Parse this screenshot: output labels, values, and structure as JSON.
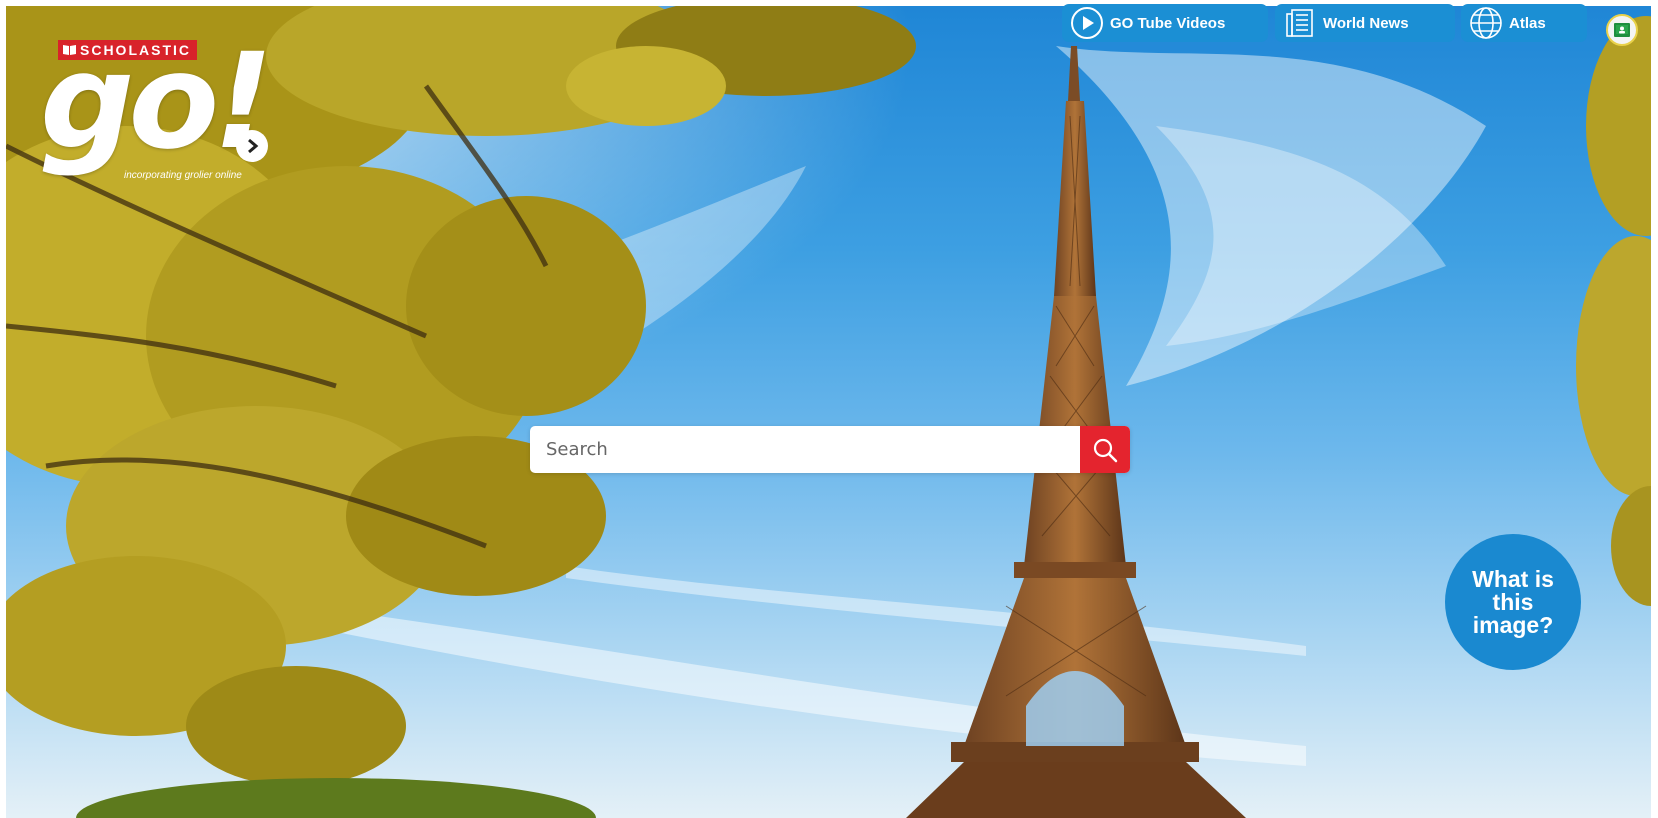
{
  "logo": {
    "brand": "SCHOLASTIC",
    "name": "go!",
    "tagline": "incorporating grolier online"
  },
  "nav": {
    "gotube": {
      "label": "GO Tube Videos",
      "icon": "play-circle-icon"
    },
    "news": {
      "label": "World News",
      "icon": "newspaper-icon"
    },
    "atlas": {
      "label": "Atlas",
      "icon": "globe-icon"
    }
  },
  "search": {
    "placeholder": "Search",
    "button_icon": "search-icon"
  },
  "image_info": {
    "label": "What is this image?"
  },
  "colors": {
    "nav_blue": "#1b8fd4",
    "search_red": "#e4242e",
    "brand_red": "#d8232a",
    "badge_blue": "#1a89d0"
  }
}
